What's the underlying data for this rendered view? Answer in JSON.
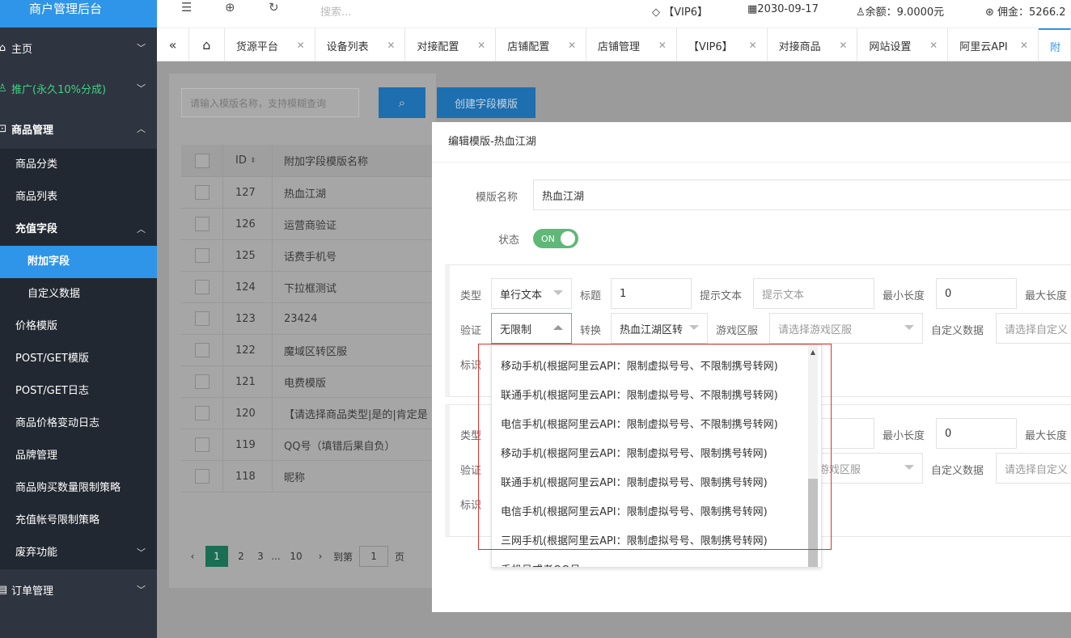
{
  "app": {
    "title": "商户管理后台"
  },
  "sidebar": {
    "items": [
      {
        "label": "主页"
      },
      {
        "label": "推广(永久10%分成)"
      },
      {
        "label": "商品管理"
      },
      {
        "label": "订单管理"
      }
    ],
    "sub": {
      "category": "商品分类",
      "list": "商品列表",
      "recharge": "充值字段",
      "extra": "附加字段",
      "custom": "自定义数据",
      "price_tpl": "价格模版",
      "postget_tpl": "POST/GET模版",
      "postget_log": "POST/GET日志",
      "price_log": "商品价格变动日志",
      "brand": "品牌管理",
      "buy_limit": "商品购买数量限制策略",
      "account_limit": "充值帐号限制策略",
      "deprecated": "废弃功能"
    }
  },
  "topbar": {
    "search_placeholder": "搜索...",
    "vip": "【VIP6】",
    "date": "2030-09-17",
    "balance": "余额：9.0000元",
    "commission": "佣金：5266.2"
  },
  "tabs": [
    "货源平台",
    "设备列表",
    "对接配置",
    "店铺配置",
    "店铺管理",
    "【VIP6】",
    "对接商品",
    "网站设置",
    "阿里云API",
    "附"
  ],
  "search": {
    "placeholder": "请输入模版名称，支持模糊查询",
    "create_label": "创建字段模版"
  },
  "table": {
    "headers": [
      "ID",
      "附加字段模版名称"
    ],
    "rows": [
      {
        "id": "127",
        "name": "热血江湖"
      },
      {
        "id": "126",
        "name": "运营商验证"
      },
      {
        "id": "125",
        "name": "话费手机号"
      },
      {
        "id": "124",
        "name": "下拉框测试"
      },
      {
        "id": "123",
        "name": "23424"
      },
      {
        "id": "122",
        "name": "魔域区转区服"
      },
      {
        "id": "121",
        "name": "电费模版"
      },
      {
        "id": "120",
        "name": "【请选择商品类型|是的|肯定是"
      },
      {
        "id": "119",
        "name": "QQ号（填错后果自负）"
      },
      {
        "id": "118",
        "name": "昵称"
      }
    ]
  },
  "pager": {
    "pages": [
      "1",
      "2",
      "3",
      "...",
      "10"
    ],
    "goto_label": "到第",
    "goto_value": "1",
    "suffix": "页"
  },
  "modal": {
    "title": "编辑模版-热血江湖",
    "name_label": "模版名称",
    "name_value": "热血江湖",
    "status_label": "状态",
    "status_value": "ON",
    "field1": {
      "type_label": "类型",
      "type_value": "单行文本",
      "title_label": "标题",
      "title_value": "1",
      "hint_label": "提示文本",
      "hint_placeholder": "提示文本",
      "minlen_label": "最小长度",
      "minlen_value": "0",
      "maxlen_label": "最大长度",
      "verify_label": "验证",
      "verify_value": "无限制",
      "convert_label": "转换",
      "convert_value": "热血江湖区转",
      "game_label": "游戏区服",
      "game_placeholder": "请选择游戏区服",
      "custom_label": "自定义数据",
      "custom_placeholder": "请选择自定义",
      "tag_label": "标识"
    },
    "field2": {
      "type_label": "类型",
      "minlen_label": "最小长度",
      "minlen_value": "0",
      "maxlen_label": "最大长度",
      "verify_label": "验证",
      "game_placeholder": "游戏区服",
      "custom_label": "自定义数据",
      "custom_placeholder": "请选择自定义",
      "tag_label": "标识"
    }
  },
  "dropdown": {
    "options": [
      "移动手机(根据阿里云API：限制虚拟号号、不限制携号转网)",
      "联通手机(根据阿里云API：限制虚拟号号、不限制携号转网)",
      "电信手机(根据阿里云API：限制虚拟号号、不限制携号转网)",
      "移动手机(根据阿里云API：限制虚拟号号、限制携号转网)",
      "联通手机(根据阿里云API：限制虚拟号号、限制携号转网)",
      "电信手机(根据阿里云API：限制虚拟号号、限制携号转网)",
      "三网手机(根据阿里云API：限制虚拟号号、限制携号转网)",
      "手机号或者QQ号"
    ]
  },
  "colors": {
    "accent": "#2f95e8",
    "sidebar": "#2f3540",
    "toggle_on": "#5fb878",
    "highlight_box": "#e0312d"
  }
}
